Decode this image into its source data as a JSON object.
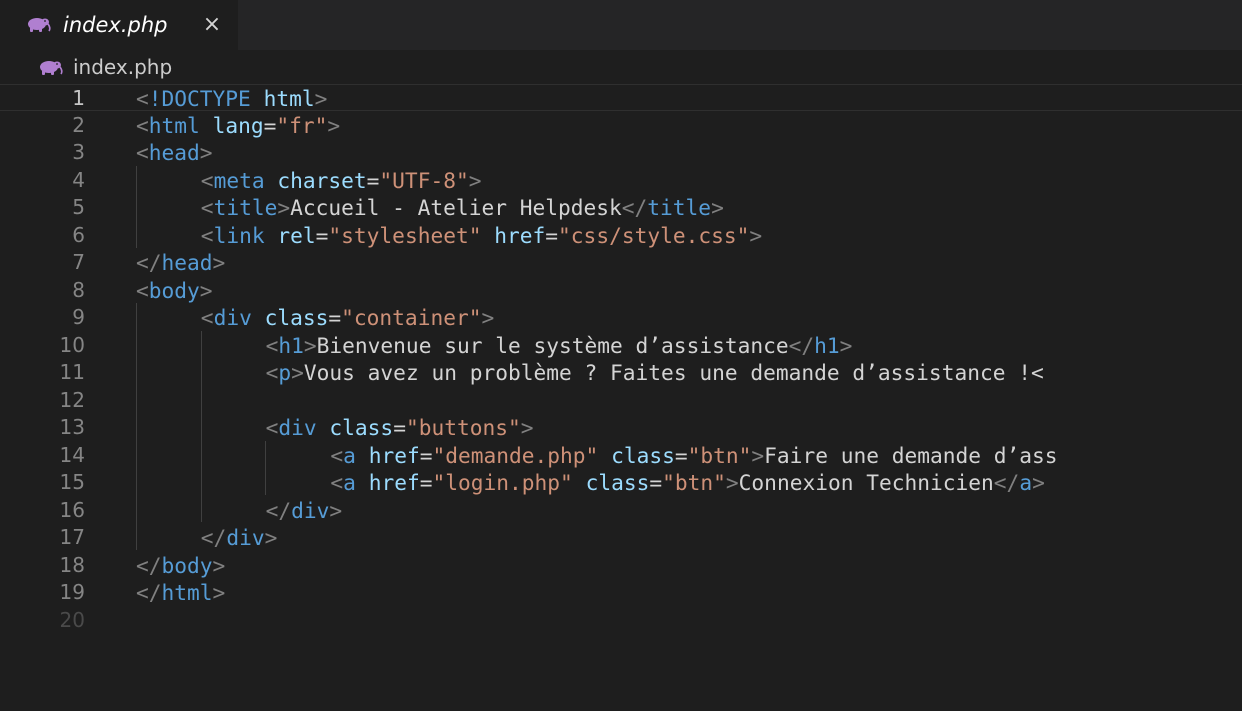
{
  "tab": {
    "icon": "php-elephant-icon",
    "label": "index.php",
    "close": "×"
  },
  "breadcrumb": {
    "icon": "php-elephant-icon",
    "label": "index.php"
  },
  "editor": {
    "active_line": 1,
    "lines": [
      {
        "n": "1",
        "indent": "",
        "tokens": [
          [
            "punc",
            "<"
          ],
          [
            "tag",
            "!DOCTYPE"
          ],
          [
            "txt",
            " "
          ],
          [
            "attr",
            "html"
          ],
          [
            "punc",
            ">"
          ]
        ]
      },
      {
        "n": "2",
        "indent": "",
        "tokens": [
          [
            "punc",
            "<"
          ],
          [
            "tag",
            "html"
          ],
          [
            "txt",
            " "
          ],
          [
            "attr",
            "lang"
          ],
          [
            "eq",
            "="
          ],
          [
            "str",
            "\"fr\""
          ],
          [
            "punc",
            ">"
          ]
        ]
      },
      {
        "n": "3",
        "indent": "",
        "tokens": [
          [
            "punc",
            "<"
          ],
          [
            "tag",
            "head"
          ],
          [
            "punc",
            ">"
          ]
        ]
      },
      {
        "n": "4",
        "indent": "    ",
        "tokens": [
          [
            "punc",
            "<"
          ],
          [
            "tag",
            "meta"
          ],
          [
            "txt",
            " "
          ],
          [
            "attr",
            "charset"
          ],
          [
            "eq",
            "="
          ],
          [
            "str",
            "\"UTF-8\""
          ],
          [
            "punc",
            ">"
          ]
        ]
      },
      {
        "n": "5",
        "indent": "    ",
        "tokens": [
          [
            "punc",
            "<"
          ],
          [
            "tag",
            "title"
          ],
          [
            "punc",
            ">"
          ],
          [
            "txt",
            "Accueil - Atelier Helpdesk"
          ],
          [
            "punc",
            "</"
          ],
          [
            "tag",
            "title"
          ],
          [
            "punc",
            ">"
          ]
        ]
      },
      {
        "n": "6",
        "indent": "    ",
        "tokens": [
          [
            "punc",
            "<"
          ],
          [
            "tag",
            "link"
          ],
          [
            "txt",
            " "
          ],
          [
            "attr",
            "rel"
          ],
          [
            "eq",
            "="
          ],
          [
            "str",
            "\"stylesheet\""
          ],
          [
            "txt",
            " "
          ],
          [
            "attr",
            "href"
          ],
          [
            "eq",
            "="
          ],
          [
            "str",
            "\"css/style.css\""
          ],
          [
            "punc",
            ">"
          ]
        ]
      },
      {
        "n": "7",
        "indent": "",
        "tokens": [
          [
            "punc",
            "</"
          ],
          [
            "tag",
            "head"
          ],
          [
            "punc",
            ">"
          ]
        ]
      },
      {
        "n": "8",
        "indent": "",
        "tokens": [
          [
            "punc",
            "<"
          ],
          [
            "tag",
            "body"
          ],
          [
            "punc",
            ">"
          ]
        ]
      },
      {
        "n": "9",
        "indent": "    ",
        "tokens": [
          [
            "punc",
            "<"
          ],
          [
            "tag",
            "div"
          ],
          [
            "txt",
            " "
          ],
          [
            "attr",
            "class"
          ],
          [
            "eq",
            "="
          ],
          [
            "str",
            "\"container\""
          ],
          [
            "punc",
            ">"
          ]
        ]
      },
      {
        "n": "10",
        "indent": "        ",
        "tokens": [
          [
            "punc",
            "<"
          ],
          [
            "tag",
            "h1"
          ],
          [
            "punc",
            ">"
          ],
          [
            "txt",
            "Bienvenue sur le système d’assistance"
          ],
          [
            "punc",
            "</"
          ],
          [
            "tag",
            "h1"
          ],
          [
            "punc",
            ">"
          ]
        ]
      },
      {
        "n": "11",
        "indent": "        ",
        "tokens": [
          [
            "punc",
            "<"
          ],
          [
            "tag",
            "p"
          ],
          [
            "punc",
            ">"
          ],
          [
            "txt",
            "Vous avez un problème ? Faites une demande d’assistance !<"
          ]
        ]
      },
      {
        "n": "12",
        "indent": "",
        "tokens": []
      },
      {
        "n": "13",
        "indent": "        ",
        "tokens": [
          [
            "punc",
            "<"
          ],
          [
            "tag",
            "div"
          ],
          [
            "txt",
            " "
          ],
          [
            "attr",
            "class"
          ],
          [
            "eq",
            "="
          ],
          [
            "str",
            "\"buttons\""
          ],
          [
            "punc",
            ">"
          ]
        ]
      },
      {
        "n": "14",
        "indent": "            ",
        "tokens": [
          [
            "punc",
            "<"
          ],
          [
            "tag",
            "a"
          ],
          [
            "txt",
            " "
          ],
          [
            "attr",
            "href"
          ],
          [
            "eq",
            "="
          ],
          [
            "str",
            "\"demande.php\""
          ],
          [
            "txt",
            " "
          ],
          [
            "attr",
            "class"
          ],
          [
            "eq",
            "="
          ],
          [
            "str",
            "\"btn\""
          ],
          [
            "punc",
            ">"
          ],
          [
            "txt",
            "Faire une demande d’ass"
          ]
        ]
      },
      {
        "n": "15",
        "indent": "            ",
        "tokens": [
          [
            "punc",
            "<"
          ],
          [
            "tag",
            "a"
          ],
          [
            "txt",
            " "
          ],
          [
            "attr",
            "href"
          ],
          [
            "eq",
            "="
          ],
          [
            "str",
            "\"login.php\""
          ],
          [
            "txt",
            " "
          ],
          [
            "attr",
            "class"
          ],
          [
            "eq",
            "="
          ],
          [
            "str",
            "\"btn\""
          ],
          [
            "punc",
            ">"
          ],
          [
            "txt",
            "Connexion Technicien"
          ],
          [
            "punc",
            "</"
          ],
          [
            "tag",
            "a"
          ],
          [
            "punc",
            ">"
          ]
        ]
      },
      {
        "n": "16",
        "indent": "        ",
        "tokens": [
          [
            "punc",
            "</"
          ],
          [
            "tag",
            "div"
          ],
          [
            "punc",
            ">"
          ]
        ]
      },
      {
        "n": "17",
        "indent": "    ",
        "tokens": [
          [
            "punc",
            "</"
          ],
          [
            "tag",
            "div"
          ],
          [
            "punc",
            ">"
          ]
        ]
      },
      {
        "n": "18",
        "indent": "",
        "tokens": [
          [
            "punc",
            "</"
          ],
          [
            "tag",
            "body"
          ],
          [
            "punc",
            ">"
          ]
        ]
      },
      {
        "n": "19",
        "indent": "",
        "tokens": [
          [
            "punc",
            "</"
          ],
          [
            "tag",
            "html"
          ],
          [
            "punc",
            ">"
          ]
        ]
      },
      {
        "n": "20",
        "indent": "",
        "tokens": []
      }
    ]
  },
  "colors": {
    "background": "#1e1e1e",
    "tag": "#569cd6",
    "attribute": "#9cdcfe",
    "string": "#ce9178",
    "text": "#d4d4d4",
    "punctuation": "#808080",
    "line_number": "#858585",
    "php_icon": "#b07fd0"
  }
}
